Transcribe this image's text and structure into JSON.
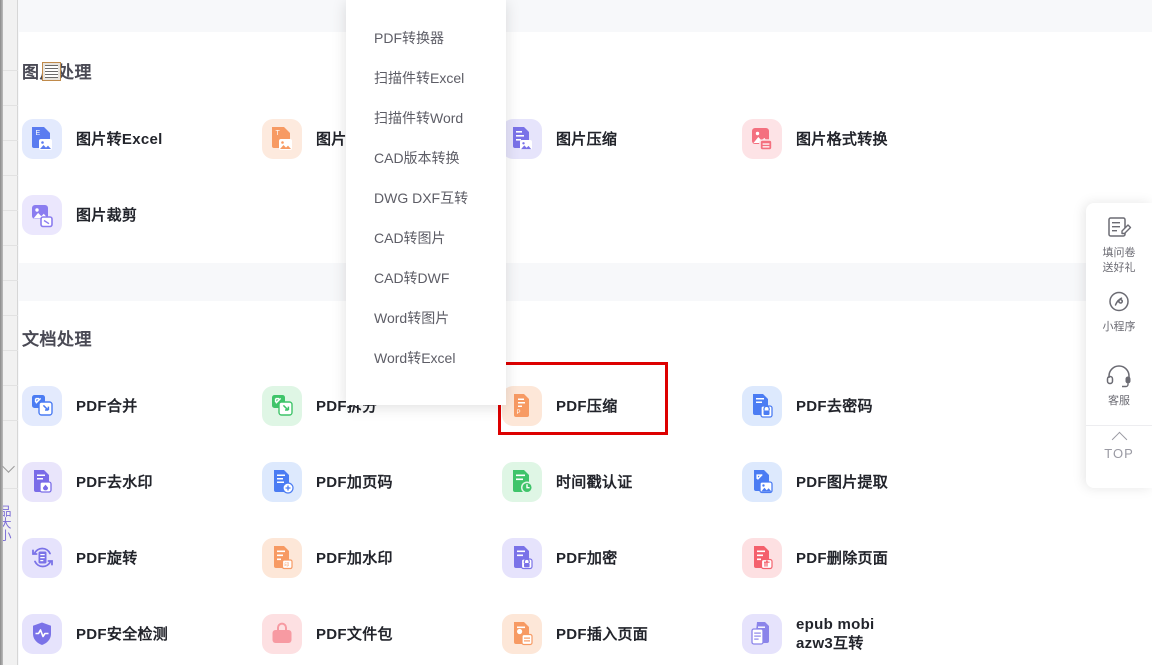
{
  "sections": [
    {
      "id": "image-processing",
      "title": "图片处理",
      "tools": [
        {
          "label": "图片转Excel",
          "icon": "image-to-excel-icon",
          "bg": "#e3eafd",
          "fg": "#5b7cf0"
        },
        {
          "label": "图片转文字",
          "icon": "image-to-text-icon",
          "bg": "#fdeade",
          "fg": "#f79a63"
        },
        {
          "label": "图片压缩",
          "icon": "image-compress-icon",
          "bg": "#e6e4fb",
          "fg": "#7a72e8"
        },
        {
          "label": "图片格式转换",
          "icon": "image-format-convert-icon",
          "bg": "#fde3e6",
          "fg": "#f4707f"
        },
        {
          "label": "图片裁剪",
          "icon": "image-crop-icon",
          "bg": "#ebe7fd",
          "fg": "#8b7df0"
        }
      ]
    },
    {
      "id": "document-processing",
      "title": "文档处理",
      "tools": [
        {
          "label": "PDF合并",
          "icon": "pdf-merge-icon",
          "bg": "#e3eafd",
          "fg": "#4b7cf3"
        },
        {
          "label": "PDF拆分",
          "icon": "pdf-split-icon",
          "bg": "#dff6e5",
          "fg": "#3fc46a"
        },
        {
          "label": "PDF压缩",
          "icon": "pdf-compress-icon",
          "bg": "#fde7d8",
          "fg": "#f79a63",
          "highlighted": true
        },
        {
          "label": "PDF去密码",
          "icon": "pdf-remove-password-icon",
          "bg": "#dde9fd",
          "fg": "#4b7cf3"
        },
        {
          "label": "PDF去水印",
          "icon": "pdf-remove-watermark-icon",
          "bg": "#e9e5fb",
          "fg": "#7a6ce8"
        },
        {
          "label": "PDF加页码",
          "icon": "pdf-add-page-number-icon",
          "bg": "#dde9fd",
          "fg": "#4b7cf3"
        },
        {
          "label": "时间戳认证",
          "icon": "timestamp-certify-icon",
          "bg": "#dff6e5",
          "fg": "#3fc46a"
        },
        {
          "label": "PDF图片提取",
          "icon": "pdf-image-extract-icon",
          "bg": "#dde9fd",
          "fg": "#4b7cf3"
        },
        {
          "label": "PDF旋转",
          "icon": "pdf-rotate-icon",
          "bg": "#e6e3fc",
          "fg": "#7a72e8"
        },
        {
          "label": "PDF加水印",
          "icon": "pdf-add-watermark-icon",
          "bg": "#fde7d8",
          "fg": "#f79a63"
        },
        {
          "label": "PDF加密",
          "icon": "pdf-encrypt-icon",
          "bg": "#e6e3fc",
          "fg": "#7a72e8"
        },
        {
          "label": "PDF删除页面",
          "icon": "pdf-delete-page-icon",
          "bg": "#fde0e2",
          "fg": "#f4606c"
        },
        {
          "label": "PDF安全检测",
          "icon": "pdf-security-check-icon",
          "bg": "#e6e3fc",
          "fg": "#7a72e8"
        },
        {
          "label": "PDF文件包",
          "icon": "pdf-package-icon",
          "bg": "#fde0e2",
          "fg": "#f79aa2"
        },
        {
          "label": "PDF插入页面",
          "icon": "pdf-insert-page-icon",
          "bg": "#fde7d8",
          "fg": "#f79a63"
        },
        {
          "label": "epub mobi\nazw3互转",
          "icon": "ebook-convert-icon",
          "bg": "#e6e3fc",
          "fg": "#8b84ea"
        }
      ]
    }
  ],
  "dropdown": {
    "items": [
      {
        "label": "PDF转换器"
      },
      {
        "label": "扫描件转Excel"
      },
      {
        "label": "扫描件转Word"
      },
      {
        "label": "CAD版本转换"
      },
      {
        "label": "DWG DXF互转"
      },
      {
        "label": "CAD转图片"
      },
      {
        "label": "CAD转DWF"
      },
      {
        "label": "Word转图片"
      },
      {
        "label": "Word转Excel"
      }
    ]
  },
  "side_panel": {
    "items": [
      {
        "label": "填问卷\n送好礼",
        "icon": "survey-icon"
      },
      {
        "label": "小程序",
        "icon": "miniprogram-icon"
      },
      {
        "label": "客服",
        "icon": "headset-icon"
      }
    ],
    "back_to_top": {
      "label": "TOP",
      "icon": "caret-up-icon"
    }
  },
  "left_edge": {
    "sliver_text": "品大小"
  },
  "colors": {
    "highlight_border": "#dd0000",
    "page_background": "#f7f8fa",
    "card_background": "#ffffff",
    "section_title": "#4a4a55",
    "tool_label": "#22242b"
  }
}
